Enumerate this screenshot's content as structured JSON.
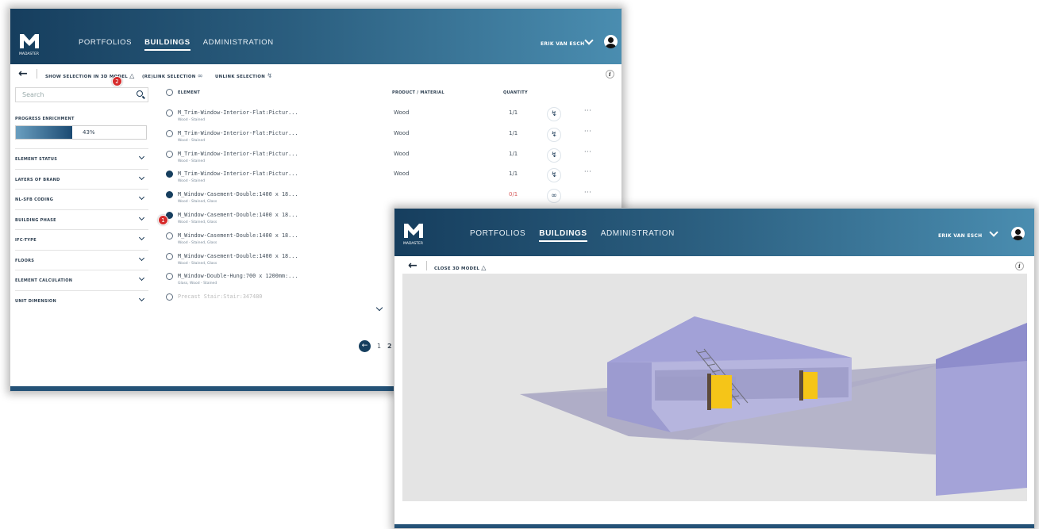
{
  "brand": {
    "logo_text": "MADASTER"
  },
  "nav": {
    "portfolios": "PORTFOLIOS",
    "buildings": "BUILDINGS",
    "administration": "ADMINISTRATION"
  },
  "user": {
    "name": "ERIK VAN ESCH"
  },
  "list_view": {
    "toolbar": {
      "show_3d": "SHOW SELECTION IN 3D MODEL",
      "relink": "(RE)LINK SELECTION",
      "unlink": "UNLINK SELECTION"
    },
    "search": {
      "placeholder": "Search"
    },
    "progress": {
      "label": "PROGRESS ENRICHMENT",
      "value": "43%",
      "fraction": 0.43
    },
    "filters": [
      "ELEMENT STATUS",
      "LAYERS OF BRAND",
      "NL-SFB CODING",
      "BUILDING PHASE",
      "IFC-TYPE",
      "FLOORS",
      "ELEMENT CALCULATION",
      "UNIT DIMENSION"
    ],
    "columns": {
      "element": "ELEMENT",
      "material": "PRODUCT / MATERIAL",
      "quantity": "QUANTITY"
    },
    "rows": [
      {
        "name": "M_Trim-Window-Interior-Flat:Pictur...",
        "sub": "Wood - Stained",
        "material": "Wood",
        "qty": "1/1",
        "selected": false,
        "icon": "unlink-icon"
      },
      {
        "name": "M_Trim-Window-Interior-Flat:Pictur...",
        "sub": "Wood - Stained",
        "material": "Wood",
        "qty": "1/1",
        "selected": false,
        "icon": "unlink-icon"
      },
      {
        "name": "M_Trim-Window-Interior-Flat:Pictur...",
        "sub": "Wood - Stained",
        "material": "Wood",
        "qty": "1/1",
        "selected": false,
        "icon": "unlink-icon"
      },
      {
        "name": "M_Trim-Window-Interior-Flat:Pictur...",
        "sub": "Wood - Stained",
        "material": "Wood",
        "qty": "1/1",
        "selected": true,
        "icon": "unlink-icon"
      },
      {
        "name": "M_Window-Casement-Double:1400 x 18...",
        "sub": "Wood - Stained, Glass",
        "material": "",
        "qty": "0/1",
        "selected": true,
        "icon": "link-icon"
      },
      {
        "name": "M_Window-Casement-Double:1400 x 18...",
        "sub": "Wood - Stained, Glass",
        "material": "",
        "qty": "",
        "selected": true,
        "icon": ""
      },
      {
        "name": "M_Window-Casement-Double:1400 x 18...",
        "sub": "Wood - Stained, Glass",
        "material": "",
        "qty": "",
        "selected": false,
        "icon": ""
      },
      {
        "name": "M_Window-Casement-Double:1400 x 18...",
        "sub": "Wood - Stained, Glass",
        "material": "",
        "qty": "",
        "selected": false,
        "icon": ""
      },
      {
        "name": "M_Window-Double-Hung:700 x 1200mm:...",
        "sub": "Glass, Wood - Stained",
        "material": "",
        "qty": "",
        "selected": false,
        "icon": ""
      },
      {
        "name": "Precast Stair:Stair:347480",
        "sub": "",
        "material": "",
        "qty": "",
        "selected": false,
        "icon": ""
      }
    ],
    "pagination": {
      "p1": "1",
      "p2": "2"
    },
    "badges": {
      "b1": "1",
      "b2": "2"
    }
  },
  "model_view": {
    "toolbar": {
      "close_3d": "CLOSE 3D MODEL"
    }
  },
  "colors": {
    "header_dark": "#163e5e",
    "header_light": "#4a8db0",
    "accent_yellow": "#f5c518",
    "badge_red": "#d62b2b",
    "building_purple": "#9c9bd0"
  }
}
